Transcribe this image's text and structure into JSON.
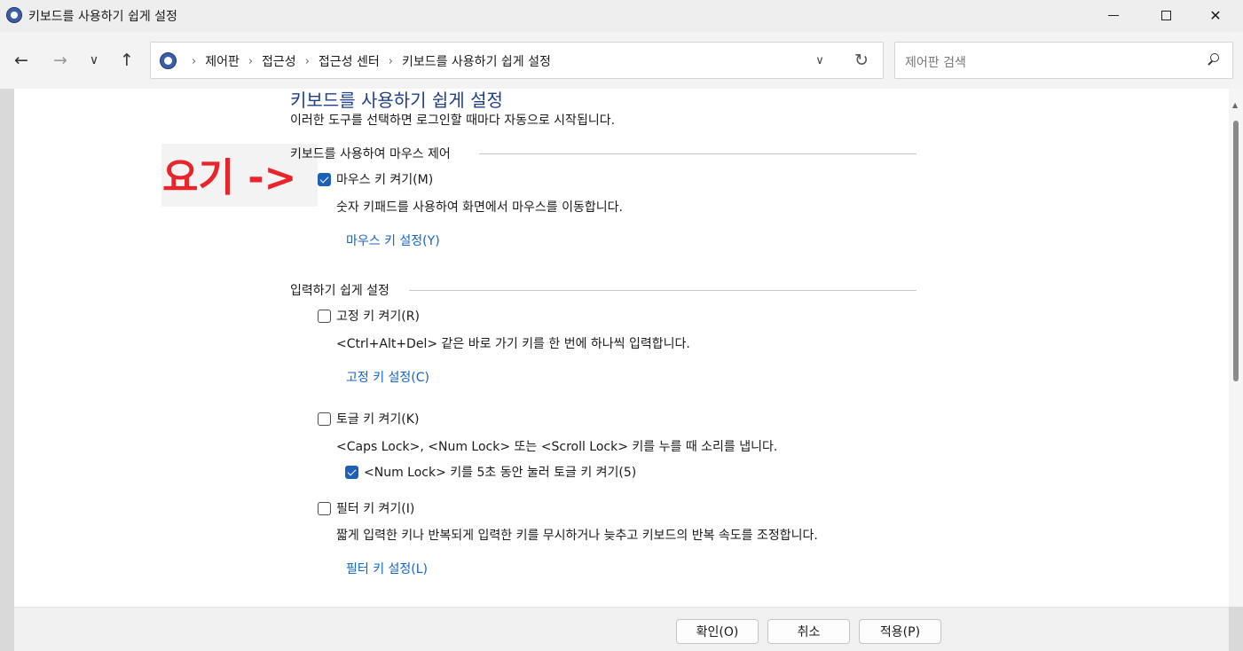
{
  "window": {
    "title": "키보드를 사용하기 쉽게 설정",
    "min_glyph": "",
    "close_glyph": "✕"
  },
  "nav": {
    "back_glyph": "←",
    "forward_glyph": "→",
    "recent_glyph": "∨",
    "up_glyph": "↑"
  },
  "address": {
    "crumbs": [
      "제어판",
      "접근성",
      "접근성 센터",
      "키보드를 사용하기 쉽게 설정"
    ],
    "sep_glyph": "›",
    "dropdown_glyph": "∨",
    "refresh_glyph": "↻"
  },
  "search": {
    "placeholder": "제어판 검색"
  },
  "page": {
    "title": "키보드를 사용하기 쉽게 설정",
    "subtitle": "이러한 도구를 선택하면 로그인할 때마다 자동으로 시작됩니다."
  },
  "annotation": {
    "text": "요기 ->"
  },
  "mouse_section": {
    "heading": "키보드를 사용하여 마우스 제어",
    "mouse_keys": {
      "label": "마우스 키 켜기(M)",
      "checked": true,
      "desc": "숫자 키패드를 사용하여 화면에서 마우스를 이동합니다.",
      "link": "마우스 키 설정(Y)"
    }
  },
  "input_section": {
    "heading": "입력하기 쉽게 설정",
    "sticky_keys": {
      "label": "고정 키 켜기(R)",
      "checked": false,
      "desc": "<Ctrl+Alt+Del> 같은 바로 가기 키를 한 번에 하나씩 입력합니다.",
      "link": "고정 키 설정(C)"
    },
    "toggle_keys": {
      "label": "토글 키 켜기(K)",
      "checked": false,
      "desc": "<Caps Lock>, <Num Lock> 또는 <Scroll Lock> 키를 누를 때 소리를 냅니다.",
      "numlock_option": {
        "label": "<Num Lock> 키를 5초 동안 눌러 토글 키 켜기(5)",
        "checked": true
      }
    },
    "filter_keys": {
      "label": "필터 키 켜기(I)",
      "checked": false,
      "desc": "짧게 입력한 키나 반복되게 입력한 키를 무시하거나 늦추고 키보드의 반복 속도를 조정합니다.",
      "link": "필터 키 설정(L)"
    }
  },
  "buttons": {
    "ok": "확인(O)",
    "cancel": "취소",
    "apply": "적용(P)"
  },
  "colors": {
    "accent": "#1e5fb8",
    "link": "#1463c0",
    "title": "#1e3f8a",
    "annotation": "#e8252b"
  }
}
